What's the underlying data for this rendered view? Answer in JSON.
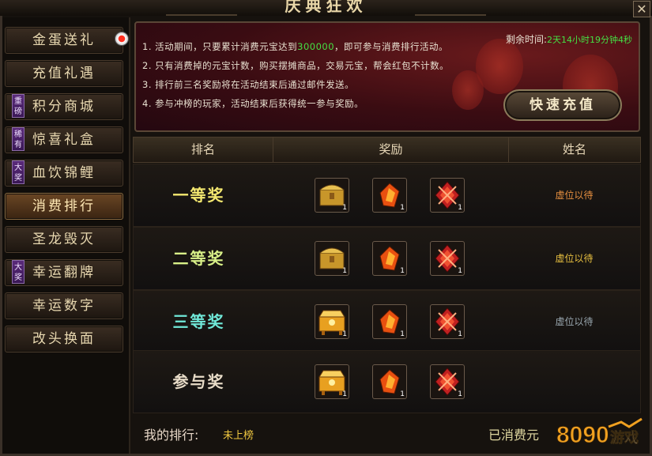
{
  "window": {
    "title": "庆典狂欢",
    "close_glyph": "✕"
  },
  "sidebar": {
    "items": [
      {
        "label": "金蛋送礼",
        "badge": "",
        "active": false
      },
      {
        "label": "充值礼遇",
        "badge": "",
        "active": false
      },
      {
        "label": "积分商城",
        "badge": "重磅",
        "active": false
      },
      {
        "label": "惊喜礼盒",
        "badge": "稀有",
        "active": false
      },
      {
        "label": "血饮锦鲤",
        "badge": "大奖",
        "active": false
      },
      {
        "label": "消费排行",
        "badge": "",
        "active": true
      },
      {
        "label": "圣龙毁灭",
        "badge": "",
        "active": false
      },
      {
        "label": "幸运翻牌",
        "badge": "大奖",
        "active": false
      },
      {
        "label": "幸运数字",
        "badge": "",
        "active": false
      },
      {
        "label": "改头换面",
        "badge": "",
        "active": false
      }
    ]
  },
  "banner": {
    "rules": [
      {
        "pre": "1. 活动期间，只要累计消费元宝达到",
        "highlight": "300000",
        "post": "，即可参与消费排行活动。"
      },
      {
        "pre": "2. 只有消费掉的元宝计数，购买摆摊商品，交易元宝，帮会红包不计数。",
        "highlight": "",
        "post": ""
      },
      {
        "pre": "3. 排行前三名奖励将在活动结束后通过邮件发送。",
        "highlight": "",
        "post": ""
      },
      {
        "pre": "4. 参与冲榜的玩家，活动结束后获得统一参与奖励。",
        "highlight": "",
        "post": ""
      }
    ],
    "timer_label": "剩余时间:",
    "timer_value": "2天14小时19分钟4秒",
    "charge_button": "快速充值"
  },
  "table": {
    "headers": {
      "rank": "排名",
      "reward": "奖励",
      "name": "姓名"
    },
    "rows": [
      {
        "rank": "一等奖",
        "rank_color": "#f4e870",
        "items": [
          "gold-chest-icon",
          "flame-gem-icon",
          "red-crystal-icon"
        ],
        "counts": [
          "1",
          "1",
          "1"
        ],
        "player": "虚位以待",
        "player_color": "#e89040"
      },
      {
        "rank": "二等奖",
        "rank_color": "#d8f088",
        "items": [
          "gold-chest-icon",
          "flame-gem-icon",
          "red-crystal-icon"
        ],
        "counts": [
          "1",
          "1",
          "1"
        ],
        "player": "虚位以待",
        "player_color": "#e8c040"
      },
      {
        "rank": "三等奖",
        "rank_color": "#70e8d8",
        "items": [
          "ornate-chest-icon",
          "flame-gem-icon",
          "red-crystal-icon"
        ],
        "counts": [
          "1",
          "1",
          "1"
        ],
        "player": "虚位以待",
        "player_color": "#9aa8b0"
      },
      {
        "rank": "参与奖",
        "rank_color": "#e8dcc8",
        "items": [
          "ornate-chest-icon",
          "flame-gem-icon",
          "red-crystal-icon"
        ],
        "counts": [
          "1",
          "1",
          "1"
        ],
        "player": "",
        "player_color": "#9aa8b0"
      }
    ]
  },
  "footer": {
    "my_rank_label": "我的排行:",
    "my_rank_value": "未上榜",
    "spent_label": "已消费元"
  },
  "watermark": {
    "text": "8090游戏"
  }
}
